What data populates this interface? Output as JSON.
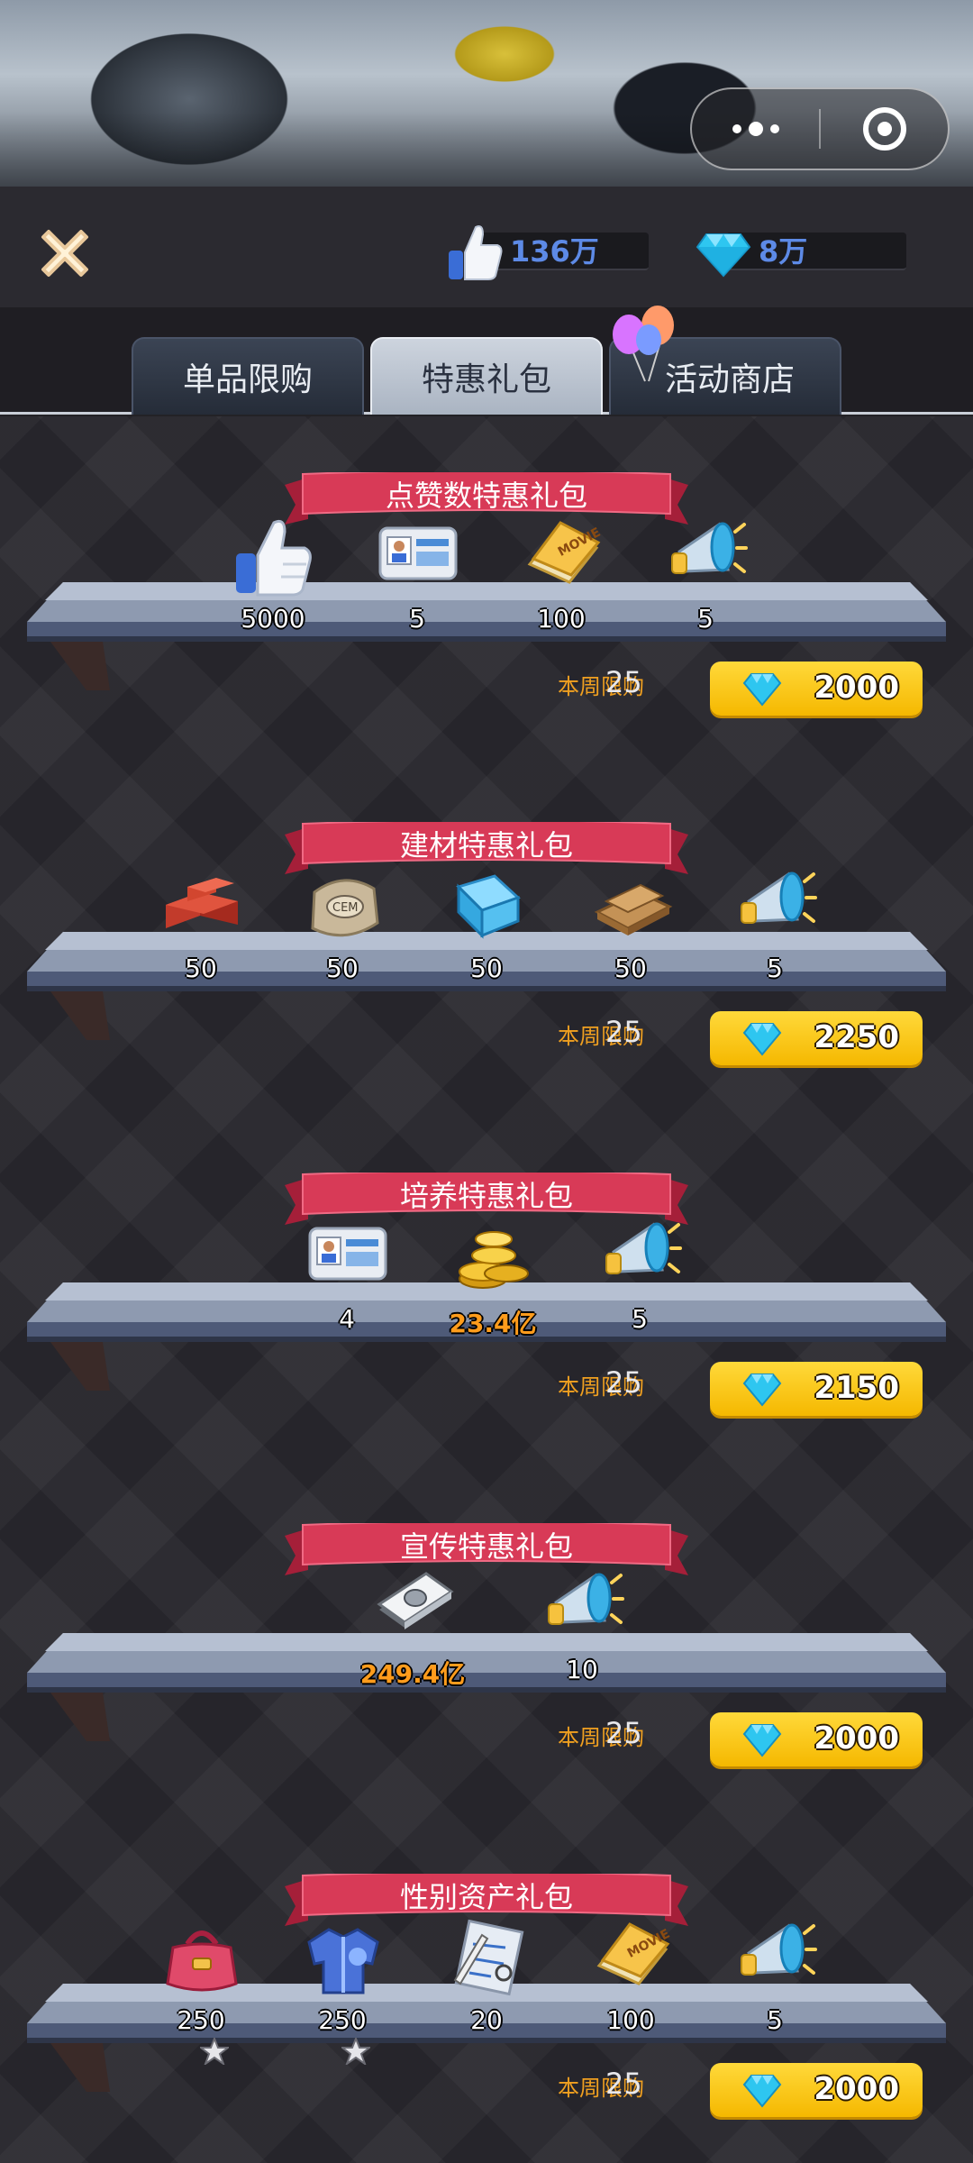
{
  "header": {
    "likes_value": "136万",
    "diamonds_value": "8万"
  },
  "tabs": [
    {
      "label": "单品限购"
    },
    {
      "label": "特惠礼包"
    },
    {
      "label": "活动商店"
    }
  ],
  "colors": {
    "accent": "#ffc400",
    "ribbon": "#d23a56",
    "limit_text": "#f0a020",
    "quantity_gold": "#ff9c1c"
  },
  "packs": [
    {
      "title": "点赞数特惠礼包",
      "items": [
        {
          "icon": "thumbs-up-icon",
          "qty": "5000"
        },
        {
          "icon": "id-card-icon",
          "qty": "5"
        },
        {
          "icon": "movie-script-icon",
          "qty": "100"
        },
        {
          "icon": "megaphone-icon",
          "qty": "5"
        }
      ],
      "limit_label": "本周限购",
      "limit_value": "25",
      "price": "2000"
    },
    {
      "title": "建材特惠礼包",
      "items": [
        {
          "icon": "bricks-icon",
          "qty": "50"
        },
        {
          "icon": "cement-bag-icon",
          "qty": "50"
        },
        {
          "icon": "glass-panel-icon",
          "qty": "50"
        },
        {
          "icon": "wood-plank-icon",
          "qty": "50"
        },
        {
          "icon": "megaphone-icon",
          "qty": "5"
        }
      ],
      "limit_label": "本周限购",
      "limit_value": "25",
      "price": "2250"
    },
    {
      "title": "培养特惠礼包",
      "items": [
        {
          "icon": "id-card-icon",
          "qty": "4"
        },
        {
          "icon": "gold-coins-icon",
          "qty": "23.4亿"
        },
        {
          "icon": "megaphone-icon",
          "qty": "5"
        }
      ],
      "limit_label": "本周限购",
      "limit_value": "25",
      "price": "2150"
    },
    {
      "title": "宣传特惠礼包",
      "items": [
        {
          "icon": "cash-stack-icon",
          "qty": "249.4亿"
        },
        {
          "icon": "megaphone-icon",
          "qty": "10"
        }
      ],
      "limit_label": "本周限购",
      "limit_value": "25",
      "price": "2000"
    },
    {
      "title": "性别资产礼包",
      "items": [
        {
          "icon": "handbag-icon",
          "qty": "250"
        },
        {
          "icon": "coat-icon",
          "qty": "250"
        },
        {
          "icon": "blueprint-icon",
          "qty": "20"
        },
        {
          "icon": "movie-script-icon",
          "qty": "100"
        },
        {
          "icon": "megaphone-icon",
          "qty": "5"
        }
      ],
      "limit_label": "本周限购",
      "limit_value": "25",
      "price": "2000"
    }
  ]
}
